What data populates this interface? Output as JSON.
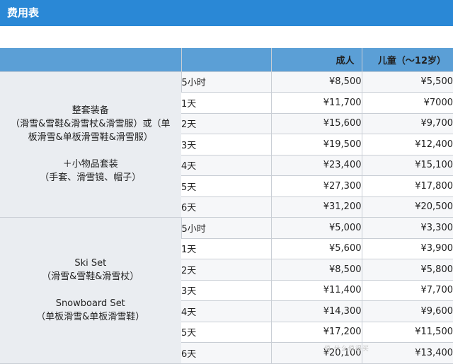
{
  "title": "费用表",
  "header": {
    "package": "",
    "duration": "",
    "adult": "成人",
    "child": "儿童（〜12岁）"
  },
  "groups": [
    {
      "lines_top": [
        "整套装备",
        "（滑雪&雪鞋&滑雪杖&滑雪服）或（单",
        "板滑雪&单板滑雪鞋&滑雪服）"
      ],
      "lines_bottom": [
        "＋小物品套装",
        "（手套、滑雪镜、帽子）"
      ],
      "rows": [
        {
          "duration": "5小时",
          "adult": "¥8,500",
          "child": "¥5,500"
        },
        {
          "duration": "1天",
          "adult": "¥11,700",
          "child": "¥7000"
        },
        {
          "duration": "2天",
          "adult": "¥15,600",
          "child": "¥9,700"
        },
        {
          "duration": "3天",
          "adult": "¥19,500",
          "child": "¥12,400"
        },
        {
          "duration": "4天",
          "adult": "¥23,400",
          "child": "¥15,100"
        },
        {
          "duration": "5天",
          "adult": "¥27,300",
          "child": "¥17,800"
        },
        {
          "duration": "6天",
          "adult": "¥31,200",
          "child": "¥20,500"
        }
      ]
    },
    {
      "lines_top": [
        "Ski Set",
        "（滑雪&雪鞋&滑雪杖）"
      ],
      "lines_bottom": [
        "Snowboard Set",
        "（单板滑雪&单板滑雪鞋）"
      ],
      "rows": [
        {
          "duration": "5小时",
          "adult": "¥5,000",
          "child": "¥3,300"
        },
        {
          "duration": "1天",
          "adult": "¥5,600",
          "child": "¥3,900"
        },
        {
          "duration": "2天",
          "adult": "¥8,500",
          "child": "¥5,800"
        },
        {
          "duration": "3天",
          "adult": "¥11,400",
          "child": "¥7,700"
        },
        {
          "duration": "4天",
          "adult": "¥14,300",
          "child": "¥9,600"
        },
        {
          "duration": "5天",
          "adult": "¥17,200",
          "child": "¥11,500"
        },
        {
          "duration": "6天",
          "adult": "¥20,100",
          "child": "¥13,400"
        }
      ]
    }
  ],
  "watermark": "值 什么值得买"
}
